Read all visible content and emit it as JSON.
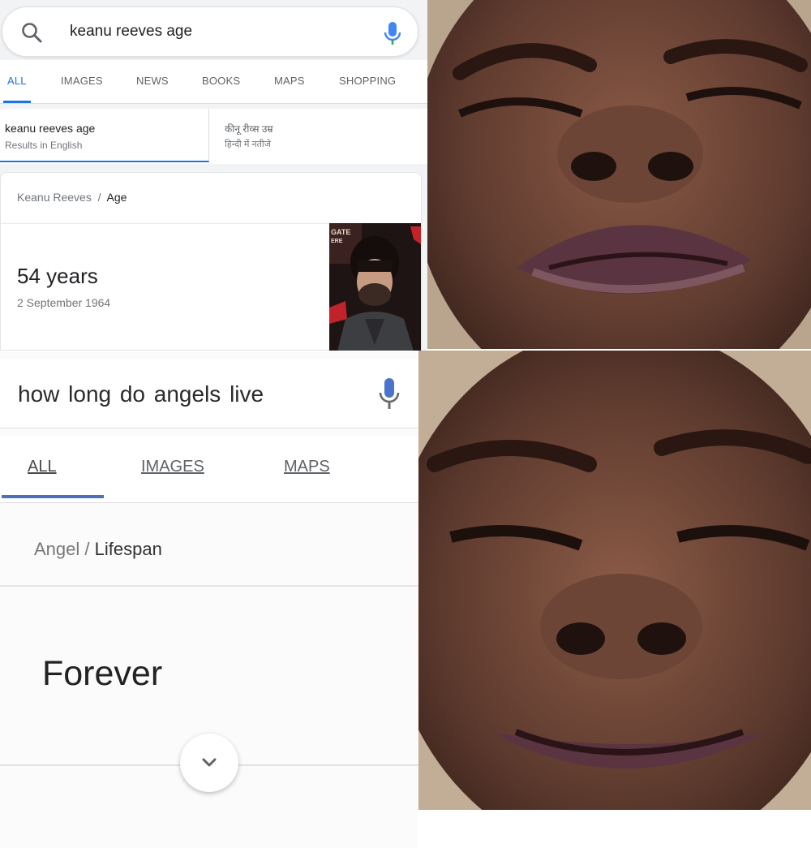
{
  "search1": {
    "query": "keanu reeves age",
    "tabs": [
      "ALL",
      "IMAGES",
      "NEWS",
      "BOOKS",
      "MAPS",
      "SHOPPING"
    ],
    "language_option_1": {
      "query": "keanu reeves age",
      "subtitle": "Results in English"
    },
    "language_option_2": {
      "query": "कीनू रीव्स उम्र",
      "subtitle": "हिन्दी में नतीजे"
    },
    "breadcrumb": {
      "entity": "Keanu Reeves",
      "separator": "/",
      "attribute": "Age"
    },
    "answer": "54 years",
    "detail": "2 September 1964",
    "photo_sign_text": "GATE\nERE"
  },
  "search2": {
    "query": "how long do  angels live",
    "tabs": [
      "ALL",
      "IMAGES",
      "MAPS"
    ],
    "breadcrumb": {
      "entity": "Angel",
      "separator": "/",
      "attribute": "Lifespan"
    },
    "answer": "Forever"
  },
  "icons": {
    "search": "search-icon",
    "mic": "microphone-icon",
    "expand": "chevron-down-icon"
  },
  "colors": {
    "accent_blue": "#1a73e8",
    "text_secondary": "#70757a"
  }
}
